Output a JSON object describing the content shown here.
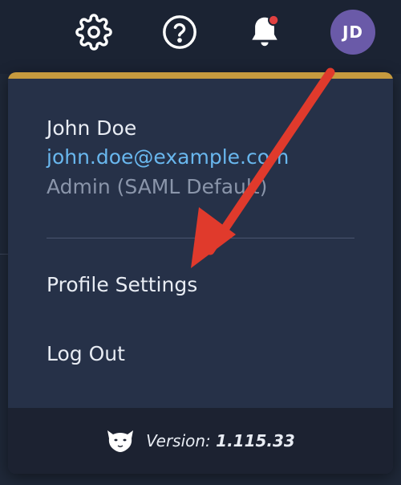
{
  "topbar": {
    "icons": [
      "gear-icon",
      "help-icon",
      "bell-icon"
    ],
    "notification_color": "#e04040",
    "avatar_initials": "JD",
    "avatar_color": "#6a5aa8"
  },
  "user_menu": {
    "accent_color": "#c69a3e",
    "name": "John Doe",
    "email": "john.doe@example.com",
    "role": "Admin (SAML Default)",
    "items": [
      {
        "label": "Profile Settings"
      },
      {
        "label": "Log Out"
      }
    ],
    "footer": {
      "logo_icon": "puma-head-icon",
      "version_label": "Version:",
      "version_number": "1.115.33"
    }
  },
  "annotation": {
    "arrow_color": "#e03a2c"
  }
}
